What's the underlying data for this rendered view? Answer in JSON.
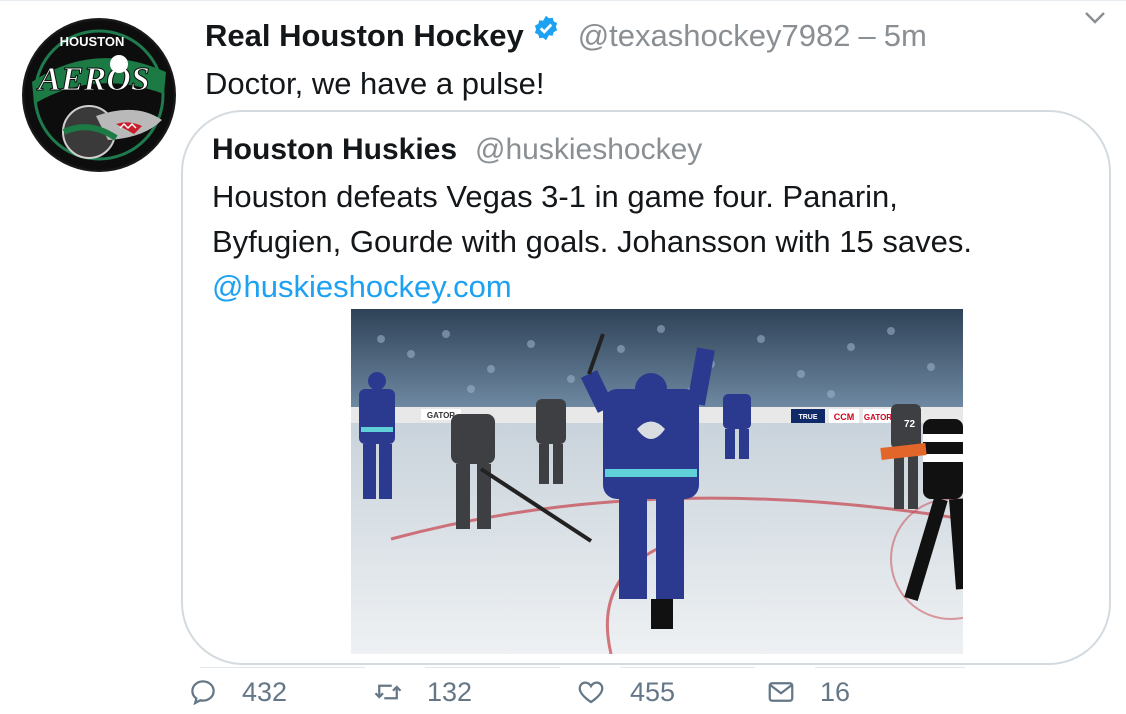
{
  "tweet": {
    "author_name": "Real Houston Hockey",
    "handle": "@texashockey7982",
    "separator": "–",
    "time": "5m",
    "text": "Doctor, we have a pulse!",
    "avatar": {
      "icon": "houston-aeros-logo",
      "label_top": "HOUSTON",
      "label_main": "AEROS"
    }
  },
  "quoted": {
    "author_name": "Houston Huskies",
    "handle": "@huskieshockey",
    "lines": [
      "Houston defeats Vegas 3-1 in game four. Panarin,",
      "Byfugien, Gourde with goals. Johansson with 15 saves."
    ],
    "link": "@huskieshockey.com",
    "media": {
      "icon": "hockey-game-screenshot",
      "boards": [
        "GATOR",
        "CCM",
        "GATOR",
        "TRUE"
      ],
      "jersey_numbers": [
        "72"
      ]
    }
  },
  "actions": {
    "reply_count": "432",
    "retweet_count": "132",
    "like_count": "455",
    "dm_count": "16"
  },
  "colors": {
    "link": "#1da1f2",
    "verified": "#1da1f2",
    "muted": "#8a8f94",
    "action": "#657786"
  }
}
